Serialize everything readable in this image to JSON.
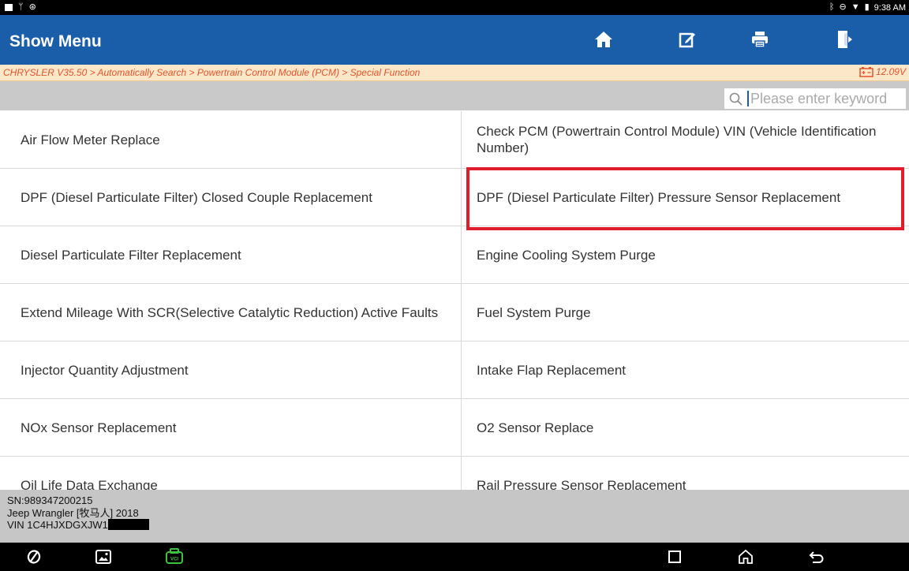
{
  "status_bar": {
    "time": "9:38 AM"
  },
  "header": {
    "title": "Show Menu",
    "buttons": [
      "home-icon",
      "edit-note-icon",
      "print-icon",
      "exit-icon"
    ]
  },
  "breadcrumb": {
    "path": "CHRYSLER V35.50 > Automatically Search > Powertrain Control Module (PCM) > Special Function",
    "voltage": "12.09V"
  },
  "search": {
    "placeholder": "Please enter keyword",
    "value": ""
  },
  "functions": [
    "Air Flow Meter Replace",
    "Check PCM (Powertrain Control Module) VIN (Vehicle Identification Number)",
    "DPF (Diesel Particulate Filter) Closed Couple Replacement",
    "DPF (Diesel Particulate Filter) Pressure Sensor Replacement",
    "Diesel Particulate Filter Replacement",
    "Engine Cooling System Purge",
    "Extend Mileage With SCR(Selective Catalytic Reduction) Active Faults",
    "Fuel System Purge",
    "Injector Quantity Adjustment",
    "Intake Flap Replacement",
    "NOx Sensor Replacement",
    "O2 Sensor Replace",
    "Oil Life Data Exchange",
    "Rail Pressure Sensor Replacement"
  ],
  "highlighted_function": "DPF (Diesel Particulate Filter) Pressure Sensor Replacement",
  "vehicle": {
    "sn": "SN:989347200215",
    "model": "Jeep Wrangler [牧马人] 2018",
    "vin": "VIN 1C4HJXDGXJW1"
  },
  "colors": {
    "header": "#1a5da8",
    "crumb_text": "#e0542a",
    "highlight": "#e01e2b",
    "vci_icon": "#3cc33c"
  }
}
